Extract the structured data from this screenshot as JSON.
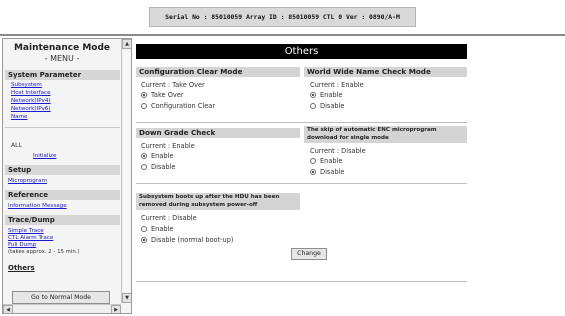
{
  "status_bar": {
    "text": "Serial No : 85010059  Array ID : 85010059  CTL 0  Ver : 0890/A-M"
  },
  "menu": {
    "title": "Maintenance Mode",
    "subtitle": "- MENU -",
    "sections": {
      "system_parameter": "System Parameter",
      "setup": "Setup",
      "reference": "Reference",
      "trace_dump": "Trace/Dump",
      "others": "Others"
    },
    "links": {
      "subsystem": "Subsystem",
      "host_interface": "Host Interface",
      "network_ipv4": "Network(IPv4)",
      "network_ipv6": "Network(IPv6)",
      "name": "Name",
      "initialize": "Initialize",
      "microprogram": "Microprogram",
      "information_message": "Information Message",
      "simple_trace": "Simple Trace",
      "ctl_alarm_trace": "CTL Alarm Trace",
      "full_dump": "Full Dump"
    },
    "all_label": "ALL",
    "full_dump_note": "(takes approx. 2 - 15 min.)",
    "go_normal_label": "Go to Normal Mode"
  },
  "page": {
    "title": "Others"
  },
  "config_clear": {
    "heading": "Configuration Clear Mode",
    "current": "Current : Take Over",
    "opt1": "Take Over",
    "opt2": "Configuration Clear"
  },
  "wwn_check": {
    "heading": "World Wide Name Check Mode",
    "current": "Current : Enable",
    "opt1": "Enable",
    "opt2": "Disable"
  },
  "down_grade": {
    "heading": "Down Grade Check",
    "current": "Current : Enable",
    "opt1": "Enable",
    "opt2": "Disable"
  },
  "enc_skip": {
    "heading": "The skip of automatic ENC microprogram download for single mode",
    "current": "Current : Disable",
    "opt1": "Enable",
    "opt2": "Disable"
  },
  "hdd_boot": {
    "heading": "Subsystem boots up after the HDU has been removed during subsystem power-off",
    "current": "Current : Disable",
    "opt1": "Enable",
    "opt2": "Disable (normal boot-up)"
  },
  "change_label": "Change"
}
